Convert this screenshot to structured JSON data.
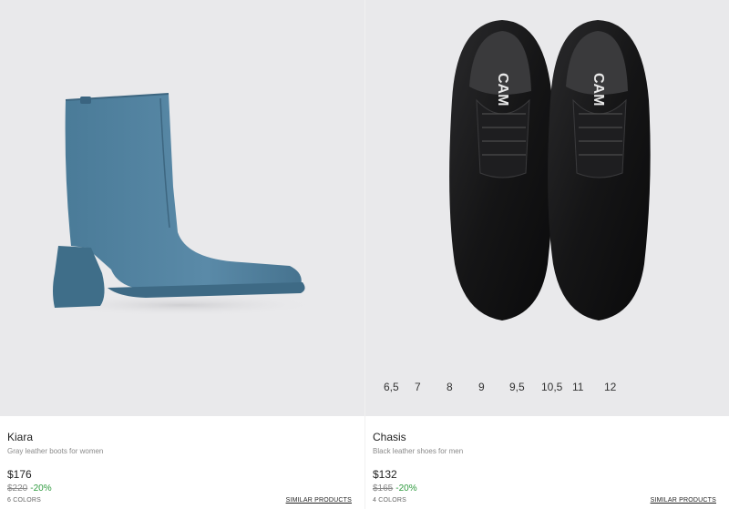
{
  "products": [
    {
      "name": "Kiara",
      "description": "Gray leather boots for women",
      "price": "$176",
      "old_price": "$220",
      "discount": "-20%",
      "colors": "6 COLORS",
      "similar": "SIMILAR PRODUCTS",
      "image_icon": "blue-ankle-boot",
      "accent_color": "#4e7f9c"
    },
    {
      "name": "Chasis",
      "description": "Black leather shoes for men",
      "price": "$132",
      "old_price": "$165",
      "discount": "-20%",
      "colors": "4 COLORS",
      "similar": "SIMILAR PRODUCTS",
      "image_icon": "black-derby-shoes",
      "sizes": [
        "6,5",
        "7",
        "8",
        "9",
        "9,5",
        "10,5",
        "11",
        "12"
      ],
      "shoe_brand_text": "CAM"
    }
  ],
  "colors": {
    "discount": "#2e9a3e",
    "image_bg": "#e9e9eb"
  }
}
